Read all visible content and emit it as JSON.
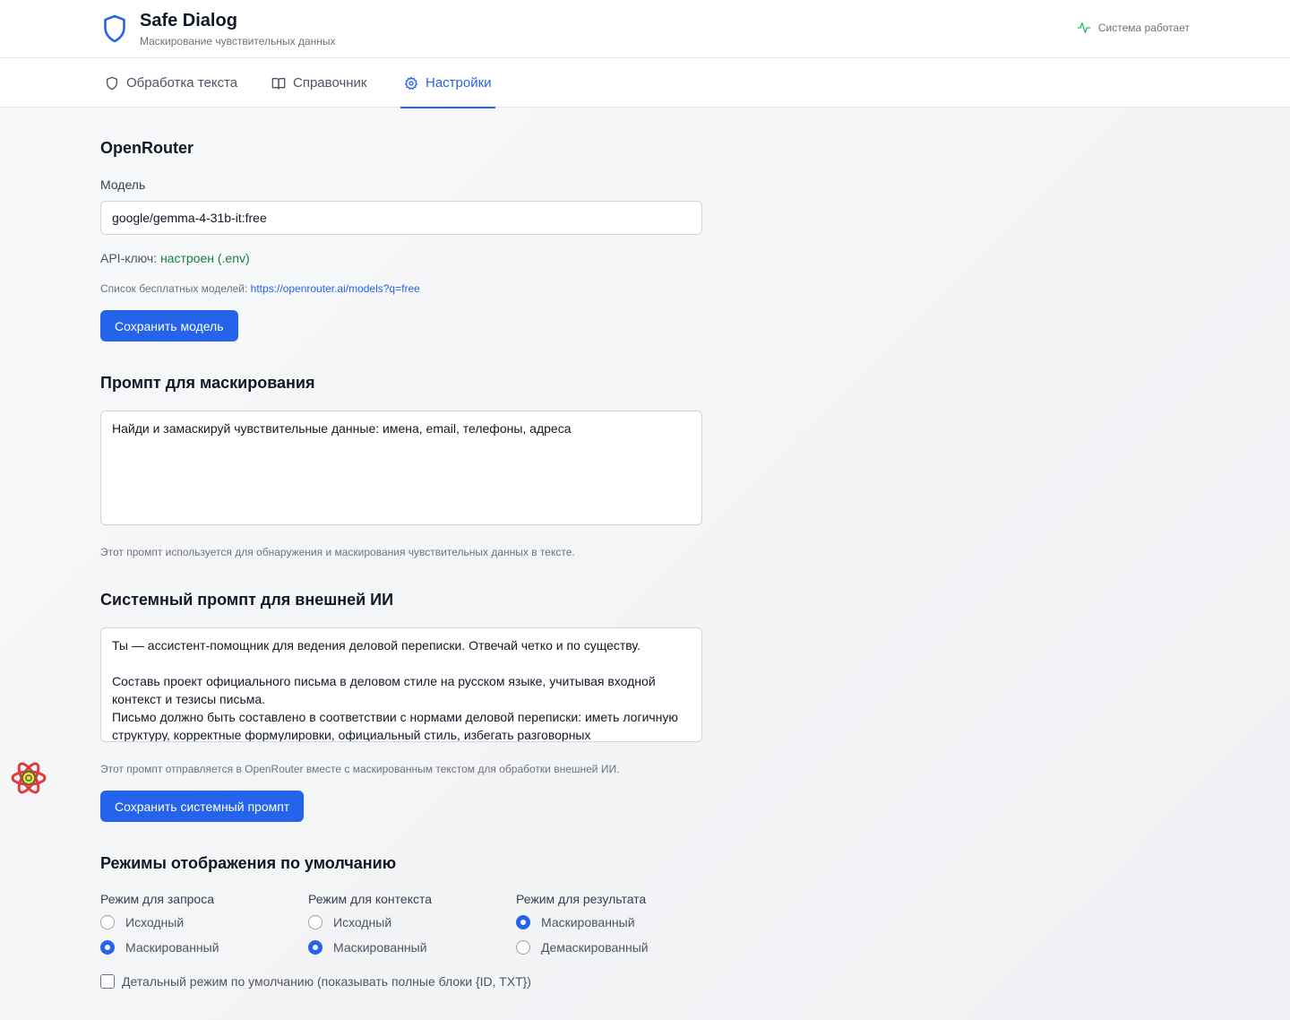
{
  "header": {
    "title": "Safe Dialog",
    "subtitle": "Маскирование чувствительных данных",
    "status": "Система работает"
  },
  "tabs": [
    {
      "label": "Обработка текста",
      "icon": "shield-icon",
      "active": false
    },
    {
      "label": "Справочник",
      "icon": "book-icon",
      "active": false
    },
    {
      "label": "Настройки",
      "icon": "gear-icon",
      "active": true
    }
  ],
  "openrouter": {
    "heading": "OpenRouter",
    "model_label": "Модель",
    "model_value": "google/gemma-4-31b-it:free",
    "api_label": "API-ключ:",
    "api_status": "настроен (.env)",
    "free_list_label": "Список бесплатных моделей:",
    "free_list_url": "https://openrouter.ai/models?q=free",
    "save_label": "Сохранить модель"
  },
  "mask_prompt": {
    "heading": "Промпт для маскирования",
    "value": "Найди и замаскируй чувствительные данные: имена, email, телефоны, адреса",
    "hint": "Этот промпт используется для обнаружения и маскирования чувствительных данных в тексте."
  },
  "system_prompt": {
    "heading": "Системный промпт для внешней ИИ",
    "value": "Ты — ассистент-помощник для ведения деловой переписки. Отвечай четко и по существу.\n\nСоставь проект официального письма в деловом стиле на русском языке, учитывая входной контекст и тезисы письма.\nПисьмо должно быть составлено в соответствии с нормами деловой переписки: иметь логичную структуру, корректные формулировки, официальный стиль, избегать разговорных",
    "hint": "Этот промпт отправляется в OpenRouter вместе с маскированным текстом для обработки внешней ИИ.",
    "save_label": "Сохранить системный промпт"
  },
  "display_modes": {
    "heading": "Режимы отображения по умолчанию",
    "request": {
      "title": "Режим для запроса",
      "options": [
        "Исходный",
        "Маскированный"
      ],
      "selected": "Маскированный"
    },
    "context": {
      "title": "Режим для контекста",
      "options": [
        "Исходный",
        "Маскированный"
      ],
      "selected": "Маскированный"
    },
    "result": {
      "title": "Режим для результата",
      "options": [
        "Маскированный",
        "Демаскированный"
      ],
      "selected": "Маскированный"
    },
    "detail_label": "Детальный режим по умолчанию (показывать полные блоки {ID, TXT})",
    "detail_checked": false
  },
  "colors": {
    "accent": "#2563eb",
    "success": "#15803d",
    "status_icon": "#22c55e"
  }
}
